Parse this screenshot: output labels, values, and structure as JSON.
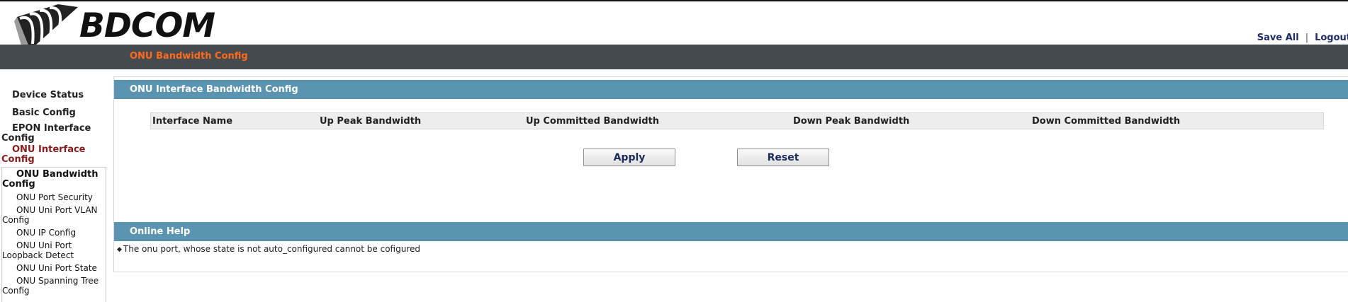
{
  "brand": {
    "name": "BDCOM"
  },
  "top_links": {
    "save_all": "Save All",
    "separator": "|",
    "logout": "Logout"
  },
  "breadcrumb": "ONU Bandwidth Config",
  "sidebar": {
    "device_status": "Device Status",
    "basic_config": "Basic Config",
    "epon_interface_config_line1": "EPON Interface",
    "epon_interface_config_line2": "Config",
    "onu_interface_config_line1": "ONU Interface",
    "onu_interface_config_line2": "Config",
    "sub_items": [
      {
        "line1": "ONU Bandwidth",
        "line2": "Config",
        "selected": true
      },
      {
        "line1": "ONU Port Security",
        "line2": ""
      },
      {
        "line1": "ONU Uni Port VLAN",
        "line2": "Config"
      },
      {
        "line1": "ONU IP Config",
        "line2": ""
      },
      {
        "line1": "ONU Uni Port",
        "line2": "Loopback Detect"
      },
      {
        "line1": "ONU Uni Port State",
        "line2": ""
      },
      {
        "line1": "ONU Spanning Tree",
        "line2": "Config"
      }
    ]
  },
  "main": {
    "section_title": "ONU Interface Bandwidth Config",
    "table_headers": [
      "Interface Name",
      "Up Peak Bandwidth",
      "Up Committed Bandwidth",
      "Down Peak Bandwidth",
      "Down Committed Bandwidth"
    ],
    "apply_label": "Apply",
    "reset_label": "Reset",
    "help_title": "Online Help",
    "help_bullet": "◆",
    "help_text": "The onu port, whose state is not auto_configured cannot be cofigured"
  },
  "colors": {
    "section_bar": "#5a94b0",
    "navbar": "#454a4f",
    "breadcrumb": "#ff6b1a",
    "active_menu": "#8b1a1a",
    "link": "#1f2a6b"
  }
}
